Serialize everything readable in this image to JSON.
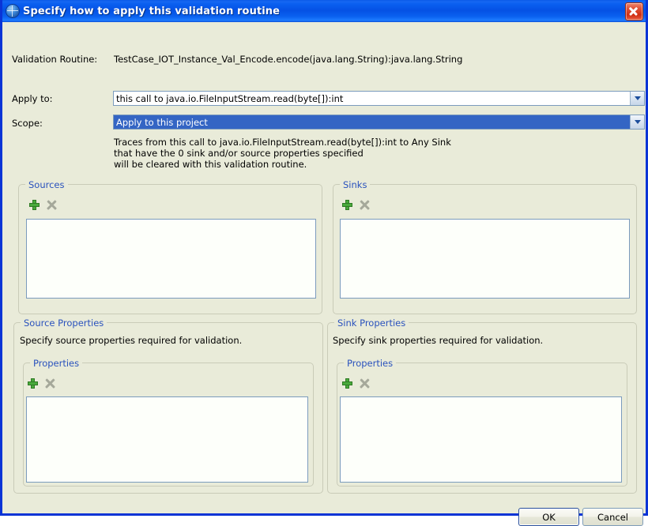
{
  "window": {
    "title": "Specify how to apply this validation routine",
    "icon": "globe-icon",
    "close_label": "Close",
    "frame_color": "#0a34d6",
    "background_color": "#e9ebd9"
  },
  "form": {
    "validation_routine_label": "Validation Routine:",
    "validation_routine_value": "TestCase_IOT_Instance_Val_Encode.encode(java.lang.String):java.lang.String",
    "apply_to_label": "Apply to:",
    "apply_to_value": "this call to java.io.FileInputStream.read(byte[]):int",
    "scope_label": "Scope:",
    "scope_value": "Apply to this project",
    "selection_color": "#3465c4"
  },
  "description": {
    "line1": "Traces from this call to java.io.FileInputStream.read(byte[]):int to Any Sink",
    "line2": "that have the 0 sink and/or source properties specified",
    "line3": "will be cleared with this validation routine."
  },
  "sources_group": {
    "label": "Sources",
    "add_label": "Add",
    "delete_label": "Delete",
    "items": []
  },
  "sinks_group": {
    "label": "Sinks",
    "add_label": "Add",
    "delete_label": "Delete",
    "items": []
  },
  "source_properties": {
    "label": "Source Properties",
    "help": "Specify source properties required for validation.",
    "inner_label": "Properties",
    "add_label": "Add",
    "delete_label": "Delete",
    "items": []
  },
  "sink_properties": {
    "label": "Sink Properties",
    "help": "Specify sink properties required for validation.",
    "inner_label": "Properties",
    "add_label": "Add",
    "delete_label": "Delete",
    "items": []
  },
  "buttons": {
    "ok": "OK",
    "cancel": "Cancel"
  }
}
